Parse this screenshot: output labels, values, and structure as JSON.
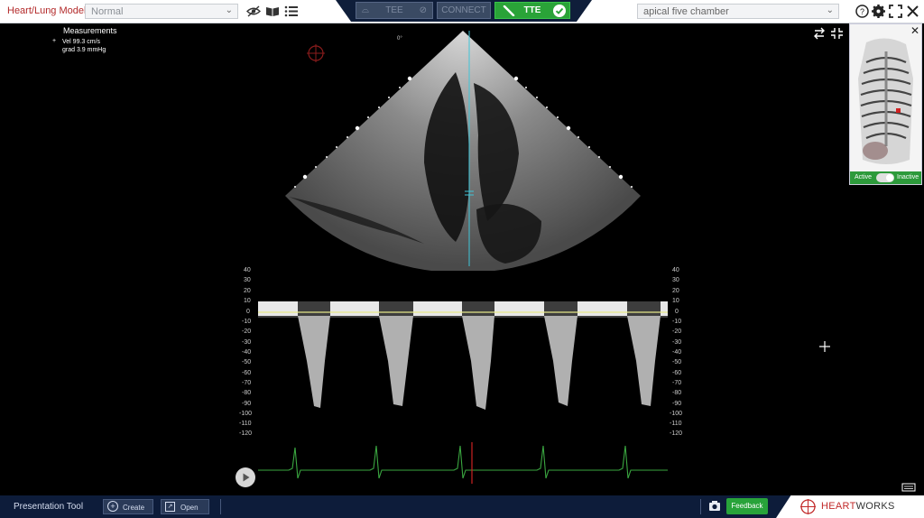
{
  "app": {
    "title": "Heart/Lung Model",
    "model_value": "Normal"
  },
  "modes": {
    "tee_label": "TEE",
    "connect_label": "CONNECT",
    "tte_label": "TTE"
  },
  "view": {
    "value": "apical five chamber"
  },
  "measurements": {
    "title": "Measurements",
    "lines": [
      "Vel 99.3 cm/s",
      "grad 3.9 mmHg"
    ]
  },
  "image": {
    "depth_label": "0°"
  },
  "doppler": {
    "scale_ticks": [
      "40",
      "30",
      "20",
      "10",
      "0",
      "-10",
      "-20",
      "-30",
      "-40",
      "-50",
      "-60",
      "-70",
      "-80",
      "-90",
      "-100",
      "-110",
      "-120"
    ]
  },
  "body_model": {
    "active_label": "Active",
    "inactive_label": "Inactive"
  },
  "bottom": {
    "presentation_label": "Presentation Tool",
    "create_label": "Create",
    "open_label": "Open",
    "feedback_label": "Feedback"
  },
  "brand": {
    "part1": "HEART",
    "part2": "WORKS",
    "accent": "#c22a2a"
  }
}
